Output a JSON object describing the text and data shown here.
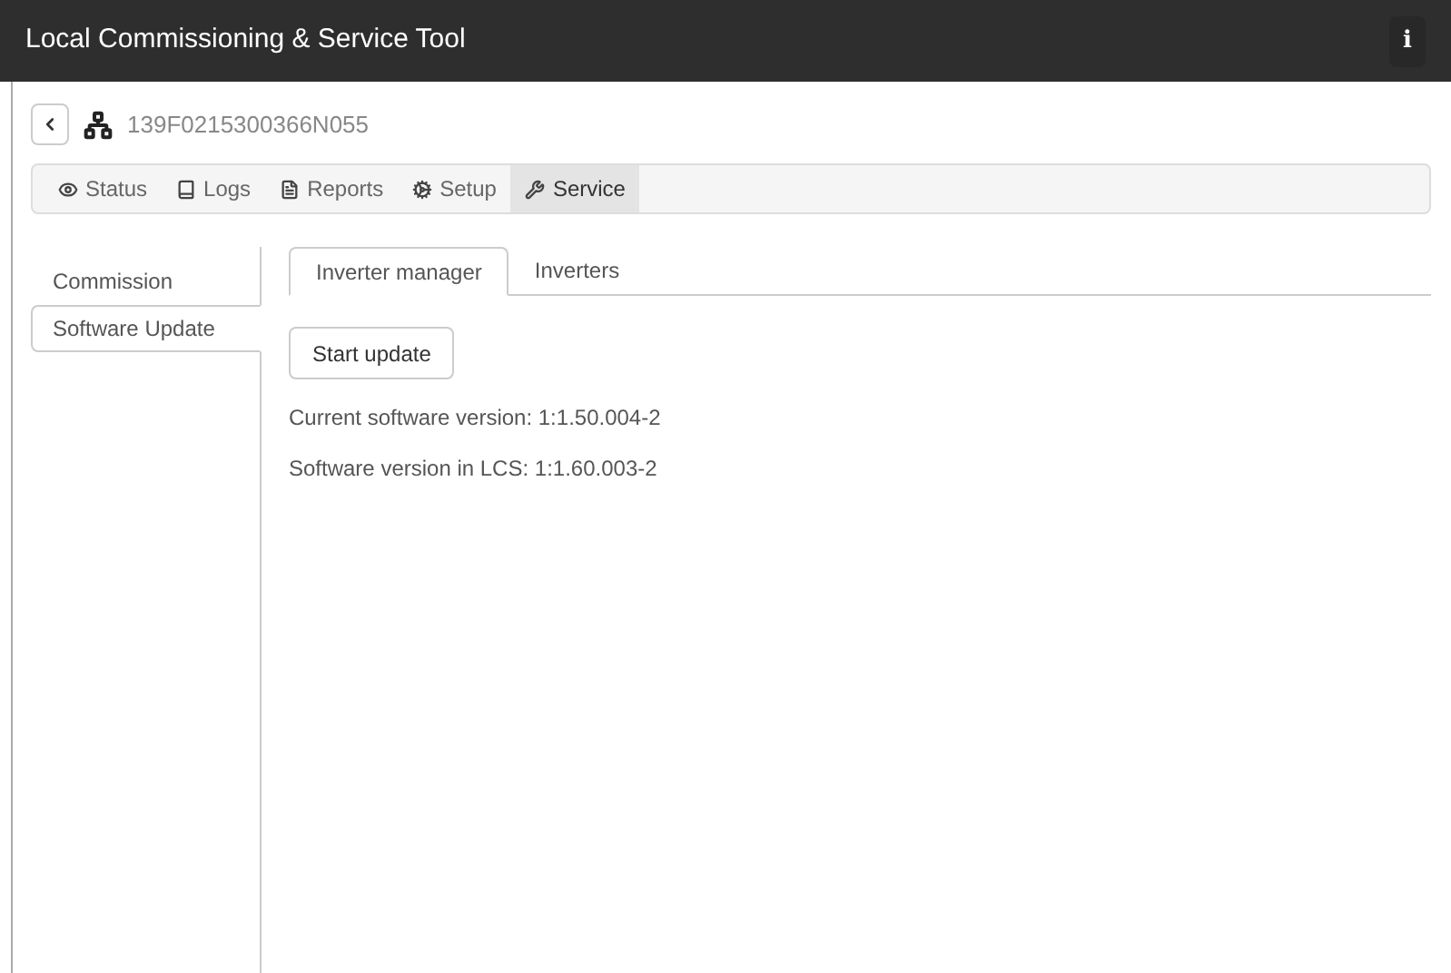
{
  "header": {
    "title": "Local Commissioning & Service Tool",
    "info_button": "i"
  },
  "device": {
    "id": "139F0215300366N055"
  },
  "nav_tabs": [
    {
      "label": "Status",
      "selected": false
    },
    {
      "label": "Logs",
      "selected": false
    },
    {
      "label": "Reports",
      "selected": false
    },
    {
      "label": "Setup",
      "selected": false
    },
    {
      "label": "Service",
      "selected": true
    }
  ],
  "side_tabs": [
    {
      "label": "Commission",
      "selected": false
    },
    {
      "label": "Software Update",
      "selected": true
    }
  ],
  "sub_tabs": [
    {
      "label": "Inverter manager",
      "selected": true
    },
    {
      "label": "Inverters",
      "selected": false
    }
  ],
  "start_button": "Start update",
  "info_lines": [
    "Current software version: 1:1.50.004-2",
    "Software version in LCS: 1:1.60.003-2"
  ]
}
